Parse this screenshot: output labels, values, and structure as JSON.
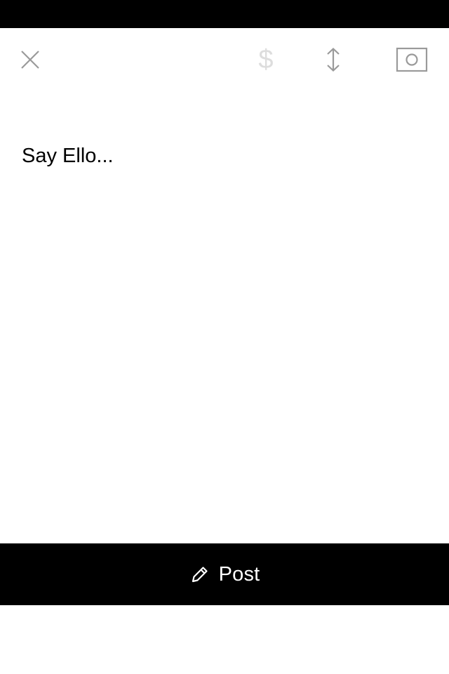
{
  "toolbar": {
    "close_icon": "close-icon",
    "money_icon": "dollar-icon",
    "reorder_icon": "reorder-icon",
    "camera_icon": "camera-icon",
    "money_symbol": "$"
  },
  "composer": {
    "placeholder": "Say Ello..."
  },
  "footer": {
    "post_label": "Post",
    "post_icon": "pencil-icon"
  },
  "colors": {
    "status_bar": "#000000",
    "background": "#ffffff",
    "icon_gray": "#9a9a9a",
    "icon_disabled": "#dddddd",
    "post_button_bg": "#000000",
    "post_button_text": "#ffffff"
  }
}
